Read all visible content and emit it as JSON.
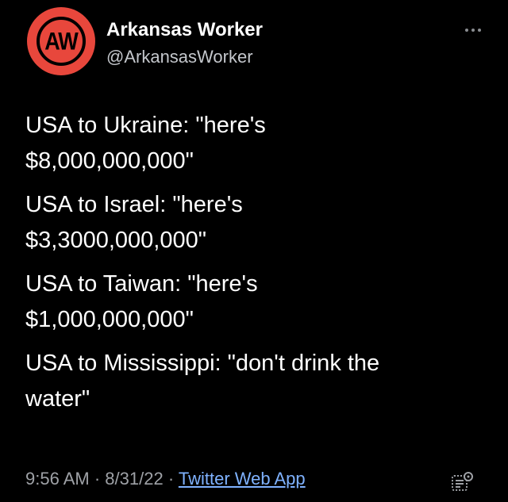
{
  "author": {
    "avatar_text": "AW",
    "name": "Arkansas Worker",
    "handle": "@ArkansasWorker",
    "avatar_color": "#e8473c"
  },
  "tweet": {
    "paragraphs": [
      {
        "line1": "USA to Ukraine: \"here's",
        "line2": "$8,000,000,000\""
      },
      {
        "line1": "USA to Israel: \"here's",
        "line2": "$3,3000,000,000\""
      },
      {
        "line1": "USA to Taiwan: \"here's",
        "line2": "$1,000,000,000\""
      },
      {
        "line1": "USA to Mississippi: \"don't drink the",
        "line2": "water\""
      }
    ]
  },
  "meta": {
    "time": "9:56 AM",
    "date": "8/31/22",
    "source": "Twitter Web App",
    "separator": "·"
  },
  "icons": {
    "more": "more-options-icon",
    "stats": "analytics-icon"
  },
  "colors": {
    "background": "#000000",
    "text": "#ffffff",
    "secondary": "#9ea1a6",
    "link": "#7fb2ff"
  }
}
